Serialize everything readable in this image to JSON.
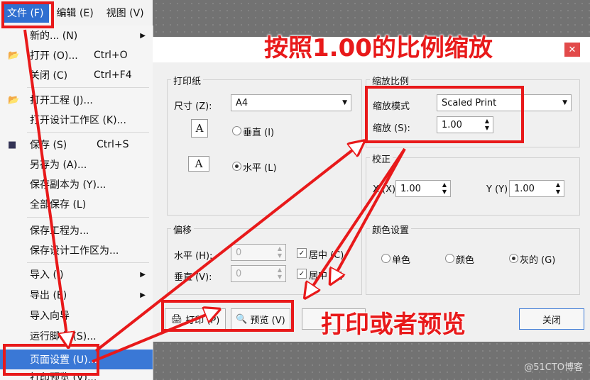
{
  "menubar": {
    "file": "文件 (F)",
    "edit": "编辑 (E)",
    "view": "视图 (V)"
  },
  "menu": {
    "new": "新的... (N)",
    "open": "打开 (O)...",
    "open_sc": "Ctrl+O",
    "close": "关闭 (C)",
    "close_sc": "Ctrl+F4",
    "open_project": "打开工程 (J)...",
    "open_workspace": "打开设计工作区 (K)...",
    "save": "保存 (S)",
    "save_sc": "Ctrl+S",
    "save_as": "另存为 (A)...",
    "save_copy": "保存副本为 (Y)...",
    "save_all": "全部保存 (L)",
    "save_project": "保存工程为...",
    "save_workspace": "保存设计工作区为...",
    "import": "导入 (I)",
    "export": "导出 (E)",
    "import_wizard": "导入向导",
    "run_script": "运行脚本 (S)...",
    "page_setup": "页面设置 (U)...",
    "print_preview": "打印预览 (V)..."
  },
  "dialog": {
    "paper_group": "打印纸",
    "size_label": "尺寸 (Z):",
    "size_value": "A4",
    "portrait": "垂直 (I)",
    "landscape": "水平 (L)",
    "scale_group": "缩放比例",
    "scale_mode_label": "缩放模式",
    "scale_mode_value": "Scaled Print",
    "scale_label": "缩放 (S):",
    "scale_value": "1.00",
    "correction_group": "校正",
    "x_label": "X (X)",
    "x_value": "1.00",
    "y_label": "Y (Y)",
    "y_value": "1.00",
    "offset_group": "偏移",
    "h_label": "水平 (H):",
    "h_value": "0",
    "v_label": "垂直 (V):",
    "v_value": "0",
    "center_h": "居中 (C)",
    "center_v": "居中 (E)",
    "color_group": "颜色设置",
    "mono": "单色",
    "color": "颜色",
    "gray": "灰的 (G)",
    "print_btn": "打印 (P)",
    "preview_btn": "预览 (V)",
    "close_btn": "关闭"
  },
  "annotations": {
    "top": "按照1.00的比例缩放",
    "bottom": "打印或者预览"
  },
  "watermark": "@51CTO博客",
  "colors": {
    "annotation": "#e8191a",
    "highlight": "#3a78d6"
  }
}
